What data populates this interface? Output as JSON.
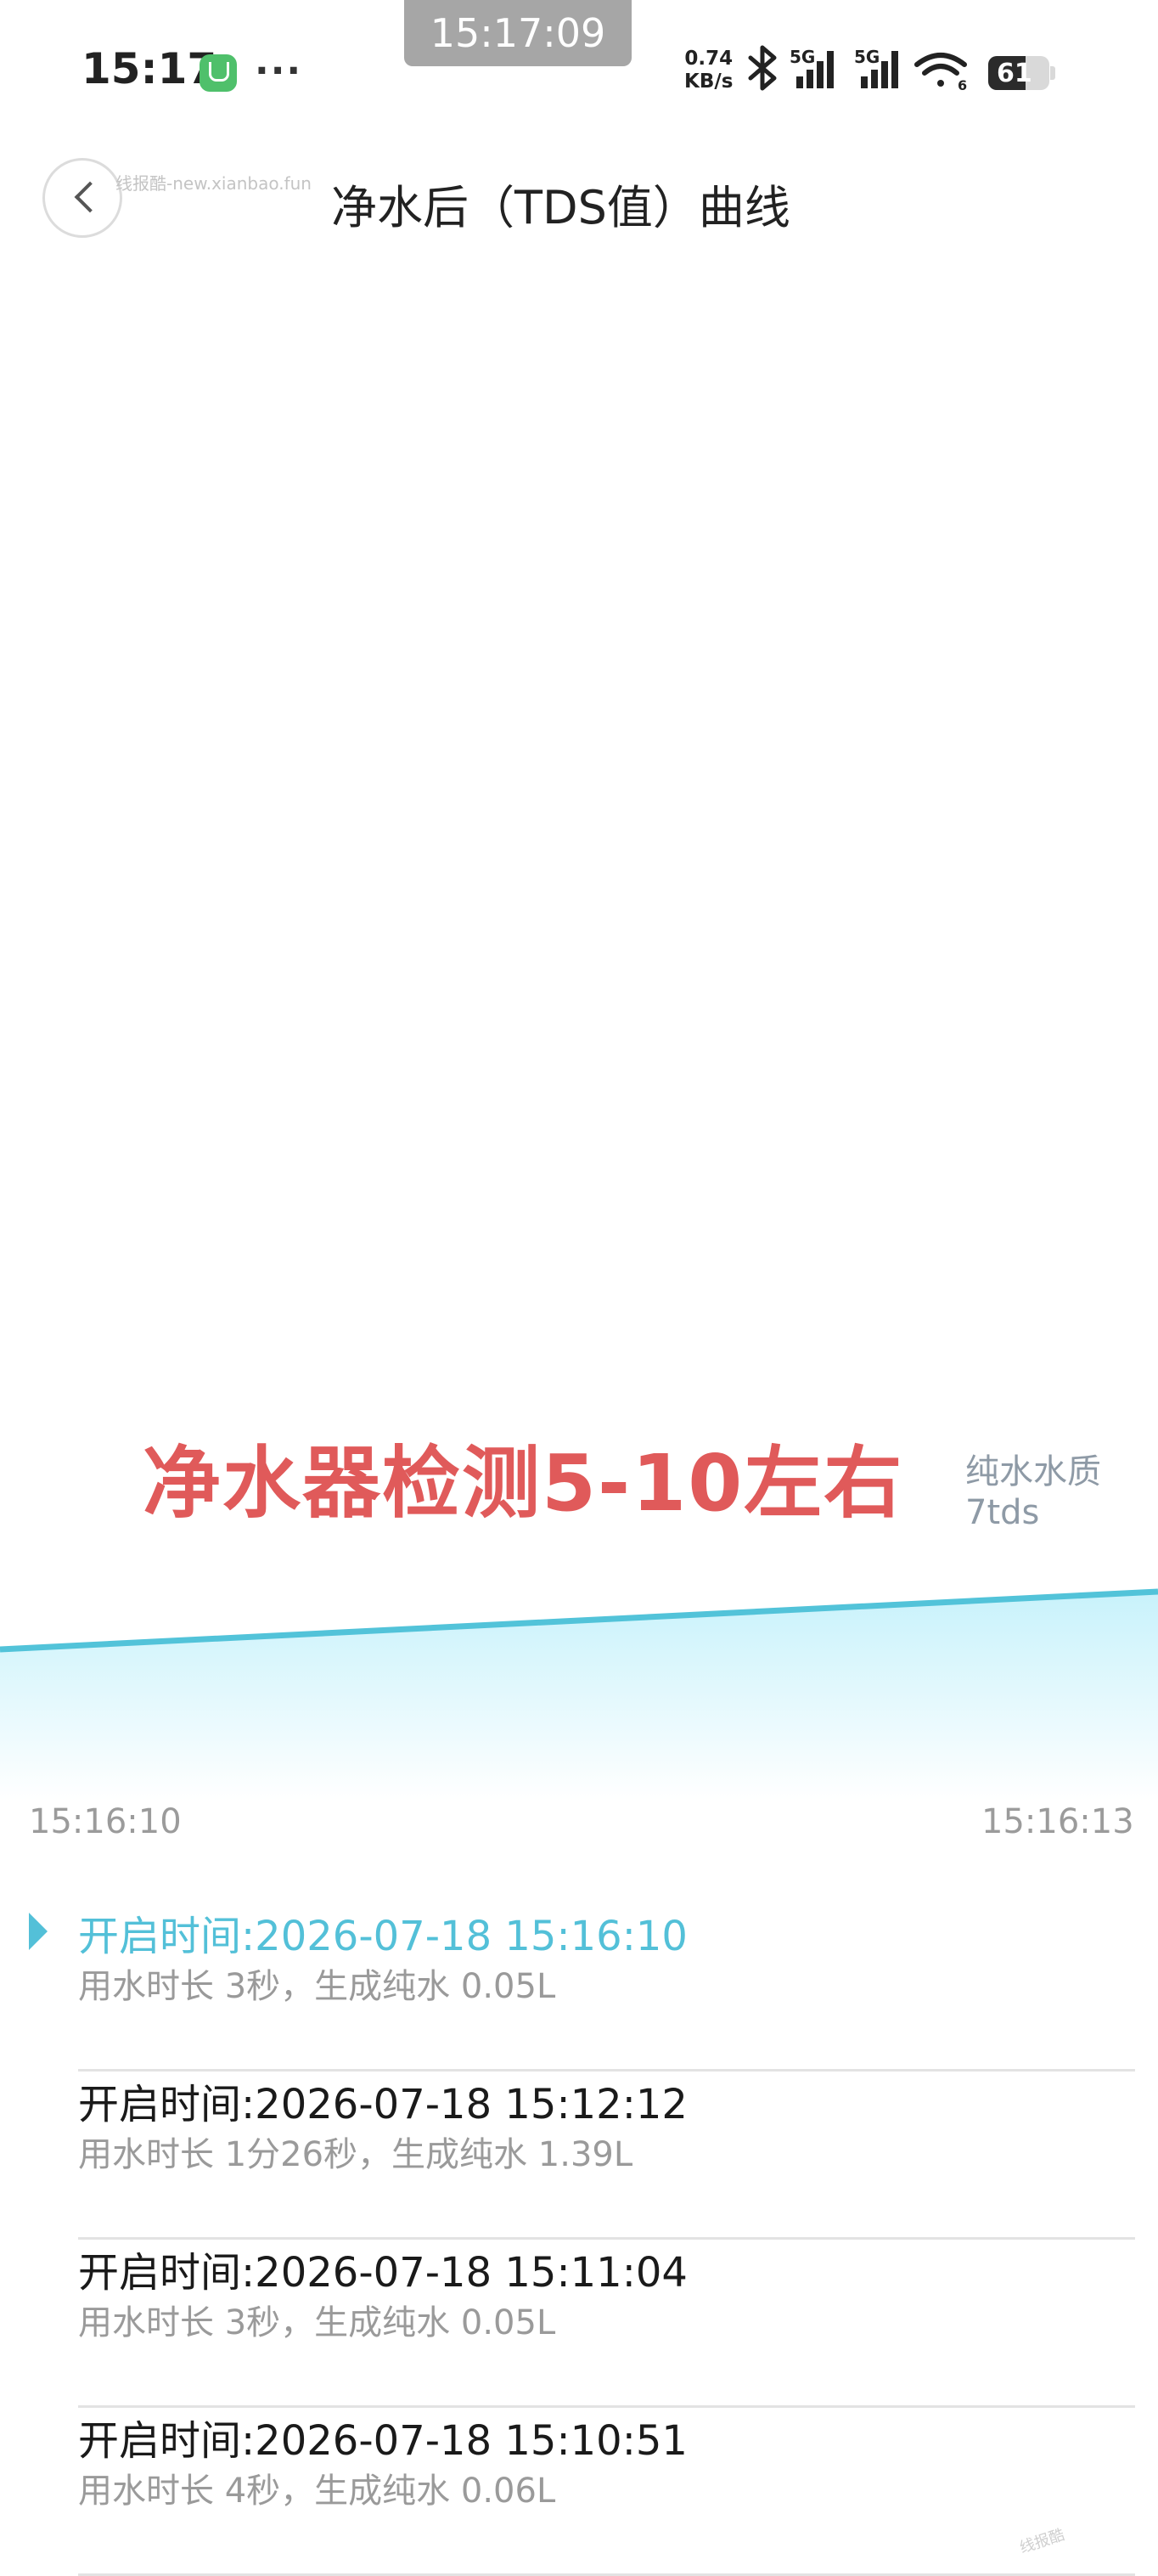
{
  "status_bar": {
    "time": "15:17",
    "floating_clock": "15:17:09",
    "net_speed_value": "0.74",
    "net_speed_unit": "KB/s",
    "signal_1_label": "5G",
    "signal_2_label": "5G",
    "wifi_badge": "6",
    "battery_percent": "61",
    "more_dots": "···",
    "icons": [
      "mi-home-app-icon",
      "bluetooth-icon",
      "cellular-signal-icon",
      "wifi-icon",
      "battery-icon"
    ]
  },
  "header": {
    "title": "净水后（TDS值）曲线",
    "watermark": "线报酷-new.xianbao.fun",
    "back_icon": "chevron-left-icon"
  },
  "overlay_annotation": "净水器检测5-10左右",
  "chart_data": {
    "type": "area",
    "x_start_label": "15:16:10",
    "x_end_label": "15:16:13",
    "legend_line1": "纯水水质",
    "legend_line2": "7tds",
    "colors": {
      "line": "#52c3d9",
      "fill_top": "#c8f2fb",
      "fill_bottom": "#ffffff"
    }
  },
  "records": [
    {
      "start": "开启时间:2026-07-18 15:16:10",
      "detail": "用水时长 3秒，生成纯水 0.05L",
      "active": true
    },
    {
      "start": "开启时间:2026-07-18 15:12:12",
      "detail": "用水时长 1分26秒，生成纯水 1.39L",
      "active": false
    },
    {
      "start": "开启时间:2026-07-18 15:11:04",
      "detail": "用水时长 3秒，生成纯水 0.05L",
      "active": false
    },
    {
      "start": "开启时间:2026-07-18 15:10:51",
      "detail": "用水时长 4秒，生成纯水 0.06L",
      "active": false
    }
  ],
  "corner_watermark": "线报酷"
}
